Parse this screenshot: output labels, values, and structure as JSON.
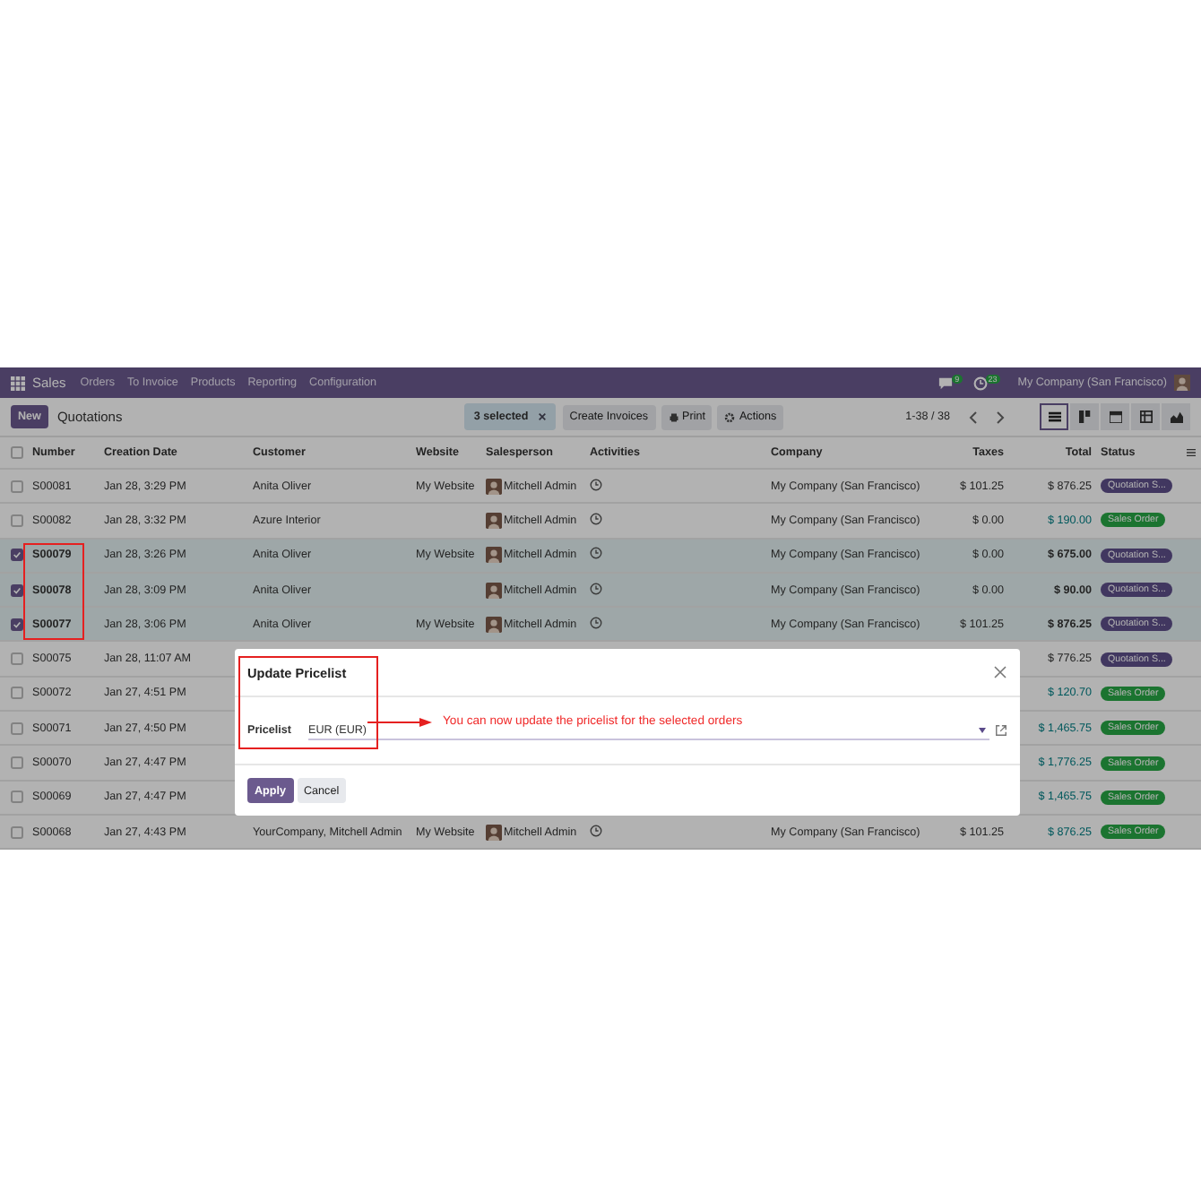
{
  "navbar": {
    "app": "Sales",
    "menu": [
      "Orders",
      "To Invoice",
      "Products",
      "Reporting",
      "Configuration"
    ],
    "messages_count": "9",
    "activities_count": "23",
    "company": "My Company (San Francisco)"
  },
  "control_bar": {
    "new_button": "New",
    "breadcrumb": "Quotations",
    "selection": "3 selected",
    "actions": [
      "Create Invoices",
      "Print",
      "Actions"
    ],
    "pager": "1-38 / 38",
    "views": [
      {
        "kind": "list",
        "selected": true
      },
      {
        "kind": "kanban",
        "selected": false
      },
      {
        "kind": "calendar",
        "selected": false
      },
      {
        "kind": "pivot",
        "selected": false
      },
      {
        "kind": "graph",
        "selected": false
      }
    ]
  },
  "table": {
    "all_selected": false,
    "columns": [
      "Number",
      "Creation Date",
      "Customer",
      "Website",
      "Salesperson",
      "Activities",
      "Company",
      "Taxes",
      "Total",
      "Status"
    ],
    "rows": [
      {
        "selected": false,
        "number": "S00081",
        "date": "Jan 28, 3:29 PM",
        "customer": "Anita Oliver",
        "website": "My Website",
        "salesperson": "Mitchell Admin",
        "company": "My Company (San Francisco)",
        "taxes": "$ 101.25",
        "total": "$ 876.25",
        "status": {
          "label": "Quotation S...",
          "kind": "quotation"
        }
      },
      {
        "selected": false,
        "number": "S00082",
        "date": "Jan 28, 3:32 PM",
        "customer": "Azure Interior",
        "salesperson": "Mitchell Admin",
        "company": "My Company (San Francisco)",
        "taxes": "$ 0.00",
        "total": "$ 190.00",
        "status": {
          "label": "Sales Order",
          "kind": "sale"
        }
      },
      {
        "selected": true,
        "number": "S00079",
        "date": "Jan 28, 3:26 PM",
        "customer": "Anita Oliver",
        "website": "My Website",
        "salesperson": "Mitchell Admin",
        "company": "My Company (San Francisco)",
        "taxes": "$ 0.00",
        "total": "$ 675.00",
        "status": {
          "label": "Quotation S...",
          "kind": "quotation"
        }
      },
      {
        "selected": true,
        "number": "S00078",
        "date": "Jan 28, 3:09 PM",
        "customer": "Anita Oliver",
        "salesperson": "Mitchell Admin",
        "company": "My Company (San Francisco)",
        "taxes": "$ 0.00",
        "total": "$ 90.00",
        "status": {
          "label": "Quotation S...",
          "kind": "quotation"
        }
      },
      {
        "selected": true,
        "number": "S00077",
        "date": "Jan 28, 3:06 PM",
        "customer": "Anita Oliver",
        "website": "My Website",
        "salesperson": "Mitchell Admin",
        "company": "My Company (San Francisco)",
        "taxes": "$ 101.25",
        "total": "$ 876.25",
        "status": {
          "label": "Quotation S...",
          "kind": "quotation"
        }
      },
      {
        "selected": false,
        "number": "S00075",
        "date": "Jan 28, 11:07 AM",
        "total": "$ 776.25",
        "status": {
          "label": "Quotation S...",
          "kind": "quotation"
        }
      },
      {
        "selected": false,
        "number": "S00072",
        "date": "Jan 27, 4:51 PM",
        "total": "$ 120.70",
        "status": {
          "label": "Sales Order",
          "kind": "sale"
        }
      },
      {
        "selected": false,
        "number": "S00071",
        "date": "Jan 27, 4:50 PM",
        "total": "$ 1,465.75",
        "status": {
          "label": "Sales Order",
          "kind": "sale"
        }
      },
      {
        "selected": false,
        "number": "S00070",
        "date": "Jan 27, 4:47 PM",
        "total": "$ 1,776.25",
        "status": {
          "label": "Sales Order",
          "kind": "sale"
        }
      },
      {
        "selected": false,
        "number": "S00069",
        "date": "Jan 27, 4:47 PM",
        "total": "$ 1,465.75",
        "status": {
          "label": "Sales Order",
          "kind": "sale"
        }
      },
      {
        "selected": false,
        "number": "S00068",
        "date": "Jan 27, 4:43 PM",
        "customer": "YourCompany, Mitchell Admin",
        "website": "My Website",
        "salesperson": "Mitchell Admin",
        "company": "My Company (San Francisco)",
        "taxes": "$ 101.25",
        "total": "$ 876.25",
        "status": {
          "label": "Sales Order",
          "kind": "sale"
        }
      }
    ]
  },
  "dialog": {
    "title": "Update Pricelist",
    "field_label": "Pricelist",
    "field_value": "EUR (EUR)",
    "buttons": [
      "Apply",
      "Cancel"
    ]
  },
  "annotation": {
    "text": "You can now update the pricelist for the selected orders"
  }
}
